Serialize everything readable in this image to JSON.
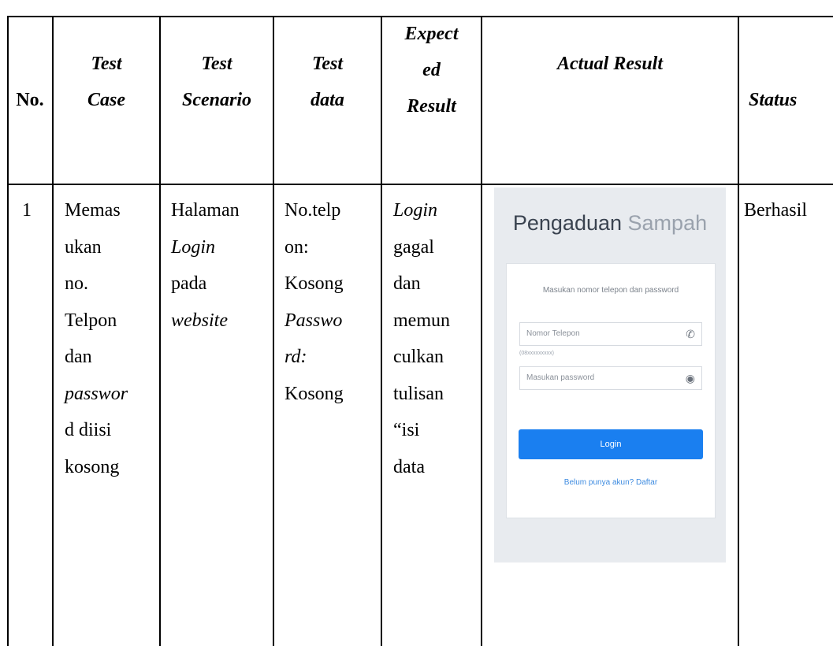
{
  "headers": {
    "no": "No.",
    "test_case": [
      "Test",
      "Case"
    ],
    "test_scenario": [
      "Test",
      "Scenario"
    ],
    "test_data": [
      "Test",
      "data"
    ],
    "expected_result": [
      "Expect",
      "ed",
      "Result"
    ],
    "actual_result": "Actual Result",
    "status": "Status"
  },
  "row": {
    "no": "1",
    "test_case": [
      "Memas",
      "ukan",
      "no.",
      "Telpon",
      "dan",
      "passwor",
      "d diisi",
      "kosong"
    ],
    "test_scenario": [
      "Halaman",
      "Login",
      "pada",
      "website"
    ],
    "test_data": [
      "No.telp",
      "on:",
      "Kosong",
      "Passwo",
      "rd:",
      "Kosong"
    ],
    "expected_result": [
      "Login",
      "gagal",
      "dan",
      "memun",
      "culkan",
      "tulisan",
      "“isi",
      "data"
    ],
    "status": "Berhasil"
  },
  "screenshot": {
    "title_bold": "Pengaduan",
    "title_light": "Sampah",
    "subtitle": "Masukan nomor telepon dan password",
    "phone_placeholder": "Nomor Telepon",
    "phone_hint": "(08xxxxxxxxx)",
    "password_placeholder": "Masukan password",
    "login_label": "Login",
    "signup_link": "Belum punya akun? Daftar",
    "button_color": "#1a7ff0"
  }
}
